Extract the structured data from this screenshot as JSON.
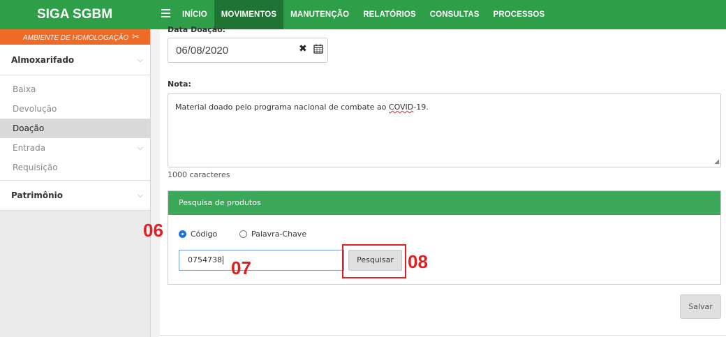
{
  "app": {
    "brand": "SIGA SGBM"
  },
  "nav": {
    "items": [
      {
        "label": "INÍCIO",
        "active": false
      },
      {
        "label": "MOVIMENTOS",
        "active": true
      },
      {
        "label": "MANUTENÇÃO",
        "active": false
      },
      {
        "label": "RELATÓRIOS",
        "active": false
      },
      {
        "label": "CONSULTAS",
        "active": false
      },
      {
        "label": "PROCESSOS",
        "active": false
      }
    ]
  },
  "sidebar": {
    "environment": "AMBIENTE DE HOMOLOGAÇÃO",
    "group1": "Almoxarifado",
    "items": [
      {
        "label": "Baixa"
      },
      {
        "label": "Devolução"
      },
      {
        "label": "Doação",
        "active": true
      },
      {
        "label": "Entrada",
        "has_children": true
      },
      {
        "label": "Requisição"
      }
    ],
    "group2": "Patrimônio"
  },
  "form": {
    "date_label": "Data Doação:",
    "date_value": "06/08/2020",
    "note_label": "Nota:",
    "note_text_before": "Material doado pelo programa nacional de combate ao ",
    "note_text_flagged": "COVID",
    "note_text_after": "-19.",
    "chars_left": "1000 caracteres"
  },
  "search_panel": {
    "title": "Pesquisa de produtos",
    "radio_code": "Código",
    "radio_keyword": "Palavra-Chave",
    "selected": "Código",
    "input_value": "0754738",
    "button_label": "Pesquisar"
  },
  "annotations": {
    "a06": "06",
    "a07": "07",
    "a08": "08"
  },
  "actions": {
    "save_label": "Salvar"
  },
  "colors": {
    "header": "#2e9e48",
    "nav_active": "#1f7434",
    "env_banner": "#ee6a26",
    "panel_head": "#3ca85a",
    "annotation": "#e02020"
  }
}
